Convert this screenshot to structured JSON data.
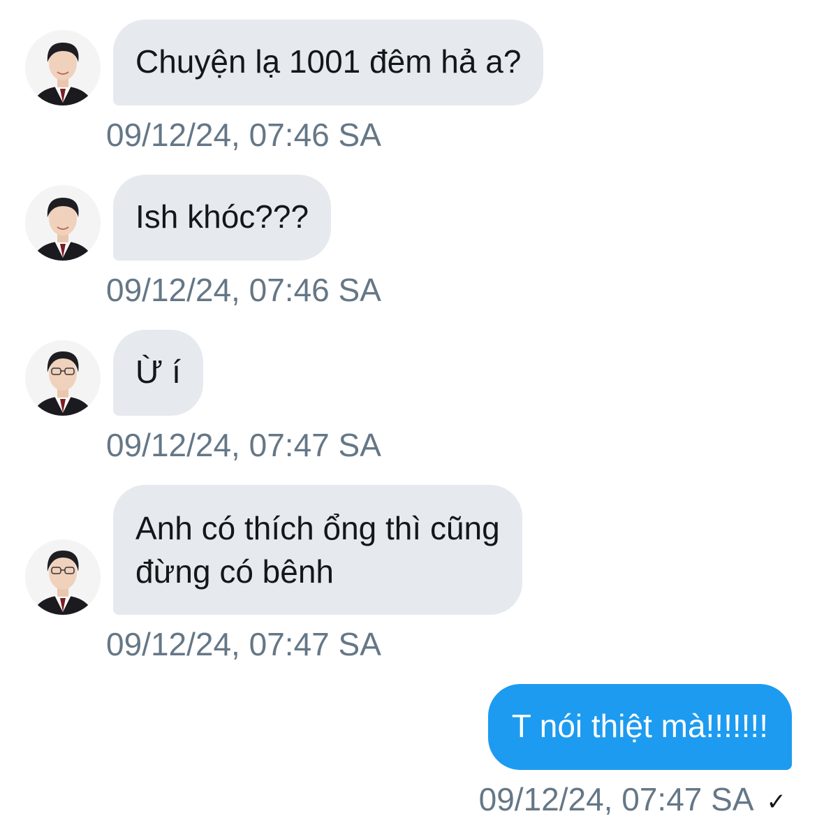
{
  "messages": [
    {
      "direction": "incoming",
      "text": "Chuyện lạ 1001 đêm hả a?",
      "timestamp": "09/12/24, 07:46 SA",
      "avatar": "avatar-user-a"
    },
    {
      "direction": "incoming",
      "text": "Ish khóc???",
      "timestamp": "09/12/24, 07:46 SA",
      "avatar": "avatar-user-a"
    },
    {
      "direction": "incoming",
      "text": "Ừ í",
      "timestamp": "09/12/24, 07:47 SA",
      "avatar": "avatar-user-b"
    },
    {
      "direction": "incoming",
      "text_line1": "Anh có thích ổng thì cũng",
      "text_line2": "đừng có bênh",
      "timestamp": "09/12/24, 07:47 SA",
      "avatar": "avatar-user-b"
    },
    {
      "direction": "outgoing",
      "text": "T nói thiệt mà!!!!!!!",
      "timestamp": "09/12/24, 07:47 SA",
      "status_icon": "checkmark-icon",
      "status_glyph": "✓"
    }
  ],
  "colors": {
    "incoming_bubble": "#e6eaee",
    "outgoing_bubble": "#1d9bf0",
    "timestamp": "#657786",
    "text": "#14171a"
  }
}
